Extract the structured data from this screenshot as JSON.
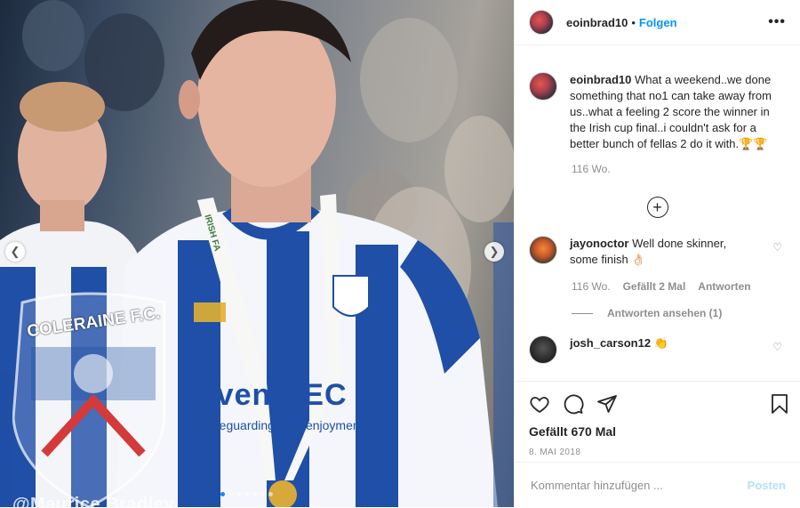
{
  "photo": {
    "crest_top_text": "COLERAINE F.C.",
    "sponsor_text": "EventSEC",
    "sponsor_sub": "safeguarding your enjoyment",
    "lanyard_text": "IRISH FA",
    "watermark": "@Maurice Bradley",
    "slide_count": 7,
    "active_slide": 1
  },
  "post": {
    "username": "eoinbrad10",
    "separator": "•",
    "follow_label": "Folgen",
    "more_icon": "more-horizontal-icon",
    "caption": "What a weekend..we done something that no1 can take away from us..what a feeling 2 score the winner in the Irish cup final..i couldn't ask for a better bunch of fellas 2 do it with.🏆🏆",
    "caption_time": "116 Wo.",
    "load_more_icon": "plus-circle-icon"
  },
  "comments": [
    {
      "username": "jayonoctor",
      "text": "Well done skinner, some finish 👌🏻",
      "time": "116 Wo.",
      "likes": "Gefällt 2 Mal",
      "reply_label": "Antworten",
      "view_replies": "Antworten ansehen (1)"
    },
    {
      "username": "josh_carson12",
      "text": "👏"
    }
  ],
  "actions": {
    "likes_label": "Gefällt 670 Mal",
    "date": "8. MAI 2018"
  },
  "add_comment": {
    "placeholder": "Kommentar hinzufügen ...",
    "post_label": "Posten"
  },
  "colors": {
    "accent": "#0095f6",
    "post_disabled": "#b2dffc",
    "kit_blue": "#1f4fa6",
    "kit_white": "#f4f6fb"
  }
}
